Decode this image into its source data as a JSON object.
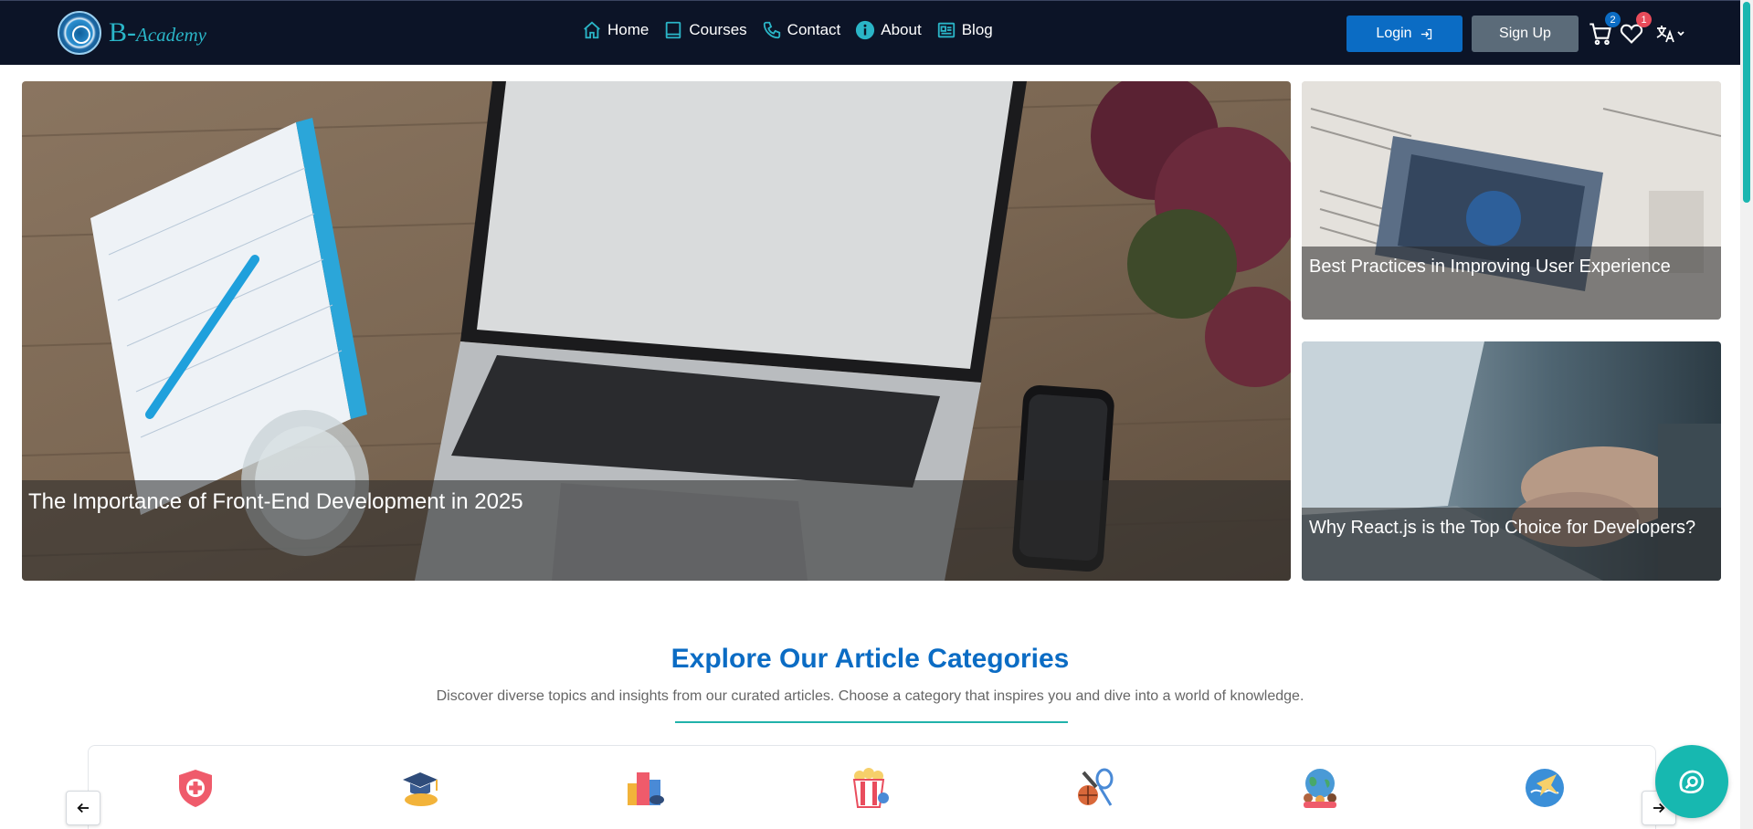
{
  "brand": {
    "letter": "B-",
    "name": "Academy"
  },
  "nav": {
    "items": [
      {
        "label": "Home",
        "icon": "home-icon"
      },
      {
        "label": "Courses",
        "icon": "book-icon"
      },
      {
        "label": "Contact",
        "icon": "phone-icon"
      },
      {
        "label": "About",
        "icon": "info-icon"
      },
      {
        "label": "Blog",
        "icon": "newspaper-icon"
      }
    ],
    "login_label": "Login",
    "signup_label": "Sign Up",
    "cart_count": "2",
    "wishlist_count": "1"
  },
  "hero": {
    "main_caption": "The Importance of Front-End Development in 2025",
    "side_top_caption": "Best Practices in Improving User Experience",
    "side_bottom_caption": "Why React.js is the Top Choice for Developers?"
  },
  "categories": {
    "title": "Explore Our Article Categories",
    "subtitle": "Discover diverse topics and insights from our curated articles. Choose a category that inspires you and dive into a world of knowledge.",
    "icons": [
      "health-icon",
      "education-icon",
      "city-icon",
      "entertainment-icon",
      "sports-icon",
      "culture-icon",
      "travel-icon"
    ]
  },
  "colors": {
    "navbar": "#0c1427",
    "accent": "#0b6cc4",
    "teal": "#17b8b0",
    "badge_blue": "#0b6cc4",
    "badge_red": "#e84b5a"
  }
}
